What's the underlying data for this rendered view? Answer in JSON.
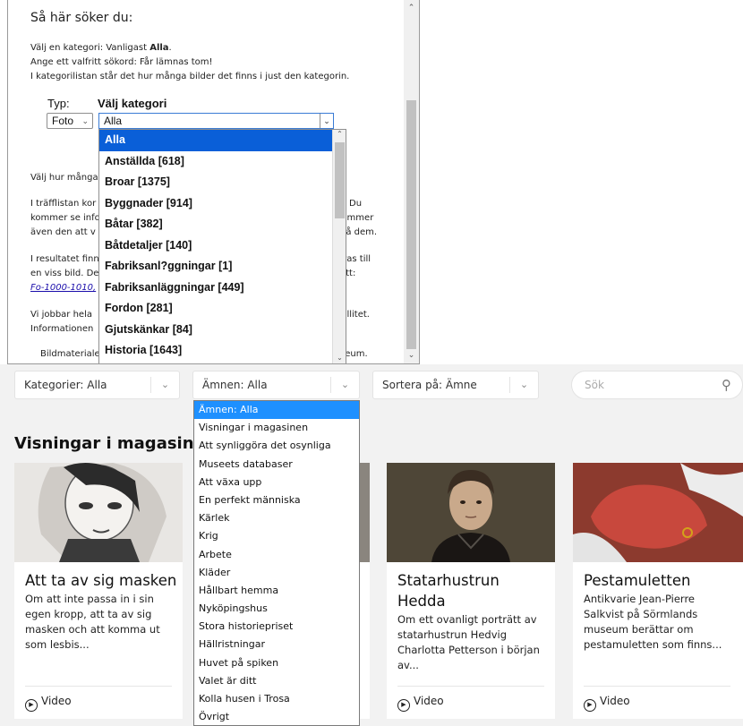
{
  "search_window": {
    "heading": "Så här söker du:",
    "lines": [
      {
        "pre": "Välj en kategori: Vanligast ",
        "bold": "Alla",
        "post": "."
      },
      {
        "pre": "Ange ett valfritt sökord: Får lämnas tom!",
        "bold": "",
        "post": ""
      },
      {
        "pre": "I kategorilistan står det hur många bilder det finns i just den kategorin.",
        "bold": "",
        "post": ""
      }
    ],
    "typ_label": "Typ:",
    "kat_label": "Välj kategori",
    "typ_value": "Foto",
    "kat_value": "Alla",
    "partial_left": [
      "Välj hur många",
      "I träfflistan kor",
      "kommer se info",
      "även den att v",
      "I resultatet finn",
      "en viss bild. De",
      "Fo-1000-1010,",
      "Vi jobbar hela",
      "Informationen",
      "Bildmateriale"
    ],
    "partial_right": [
      "Du",
      "kommer",
      "på dem.",
      "eras till",
      "ätt:",
      "hallitet.",
      "seum."
    ],
    "categories": [
      "Alla",
      "Anställda [618]",
      "Broar [1375]",
      "Byggnader [914]",
      "Båtar [382]",
      "Båtdetaljer [140]",
      "Fabriksanl?ggningar [1]",
      "Fabriksanläggningar [449]",
      "Fordon [281]",
      "Gjutskänkar [84]",
      "Historia [1643]"
    ]
  },
  "filters": {
    "kategorier": "Kategorier: Alla",
    "amnen": "Ämnen: Alla",
    "sortera": "Sortera på: Ämne",
    "search_placeholder": "Sök"
  },
  "section_title": "Visningar i magasinen",
  "amnen_options": [
    "Ämnen: Alla",
    "Visningar i magasinen",
    "Att synliggöra det osynliga",
    "Museets databaser",
    "Att växa upp",
    "En perfekt människa",
    "Kärlek",
    "Krig",
    "Arbete",
    "Kläder",
    "Hållbart hemma",
    "Nyköpingshus",
    "Stora historiepriset",
    "Hällristningar",
    "Huvet på spiken",
    "Valet är ditt",
    "Kolla husen i Trosa",
    "Övrigt"
  ],
  "cards": [
    {
      "title": "Att ta av sig masken",
      "desc": "Om att inte passa in i sin egen kropp, att ta av sig masken och att komma ut som lesbis...",
      "video": "Video"
    },
    {
      "title": "",
      "desc": "",
      "video": ""
    },
    {
      "title": "Statarhustrun Hedda",
      "desc": "Om ett ovanligt porträtt av statarhustrun Hedvig Charlotta Petterson i början av...",
      "video": "Video"
    },
    {
      "title": "Pestamuletten",
      "desc": "Antikvarie Jean-Pierre Salkvist på Sörmlands museum berättar om pestamuletten som finns...",
      "video": "Video"
    }
  ],
  "colors": {
    "accent_blue": "#0a5fd8",
    "dropdown_sel": "#1e90ff",
    "site_bg": "#f2f2f2"
  }
}
